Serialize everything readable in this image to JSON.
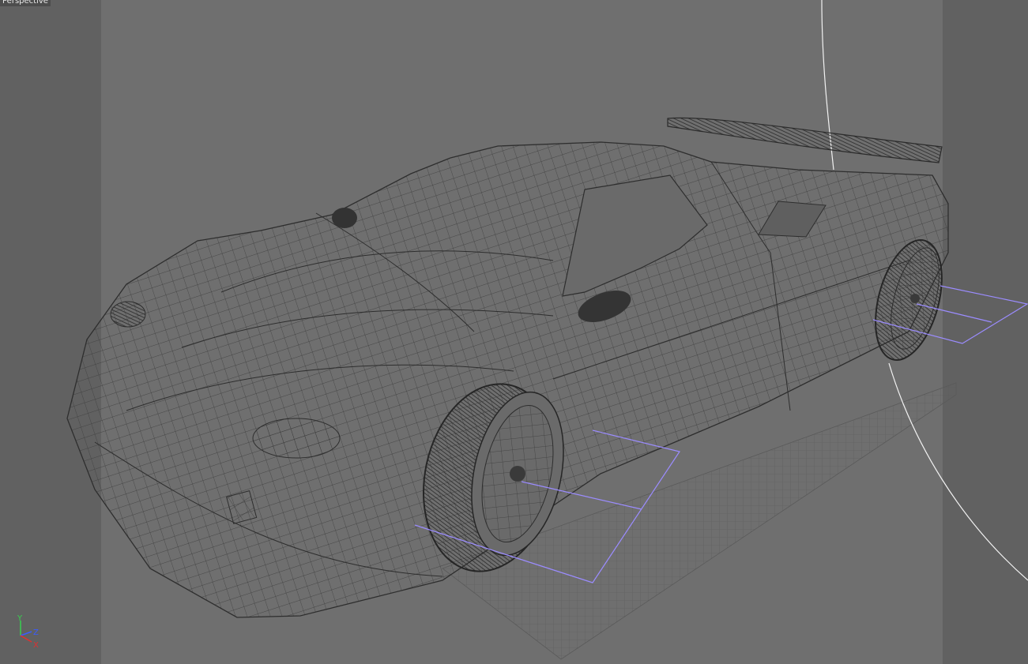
{
  "viewport": {
    "label": "Perspective",
    "gizmo": {
      "y": "Y",
      "z": "Z",
      "x": "X"
    }
  },
  "colors": {
    "background": "#6f6f6f",
    "safe_frame": "#616161",
    "wire": "#2e2e2e",
    "light_curve": "#ffffff",
    "camera_gizmo": "#9b8cff",
    "axis_y": "#37d04f",
    "axis_z": "#3a5cff",
    "axis_x": "#e03030"
  }
}
